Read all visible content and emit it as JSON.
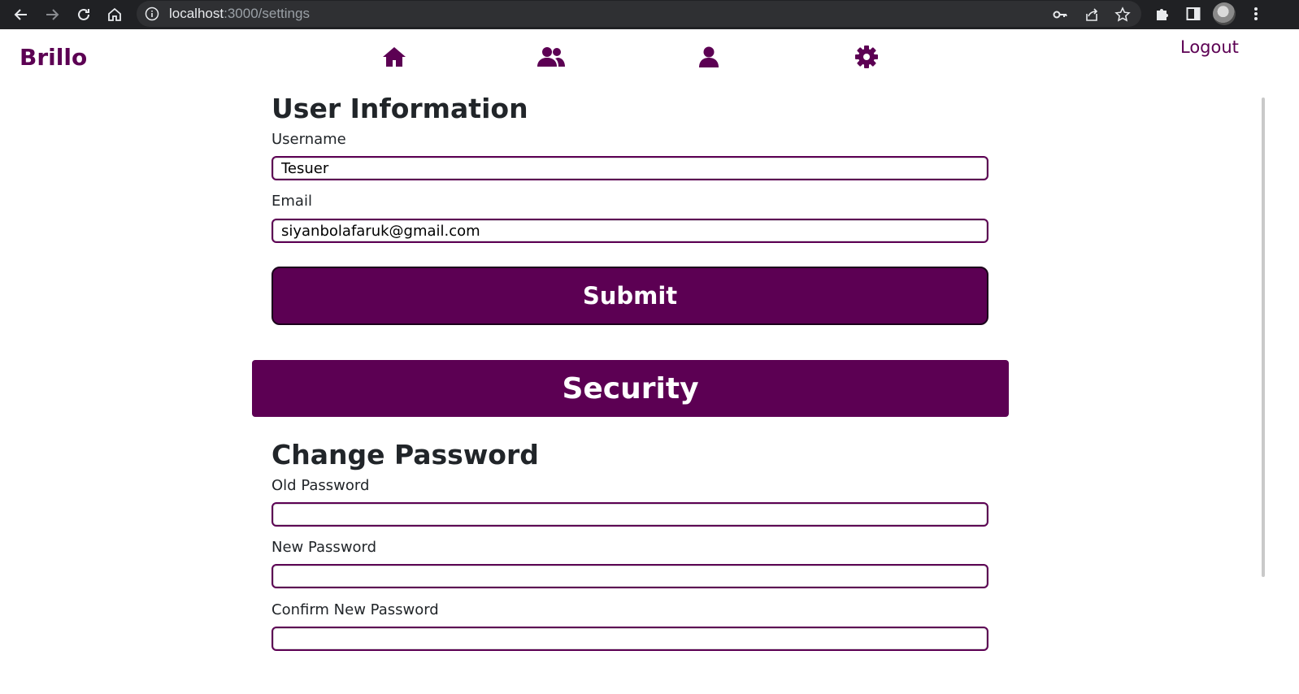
{
  "browser": {
    "url_host": "localhost",
    "url_path": ":3000/settings",
    "icons": {
      "back": "back-arrow-icon",
      "forward": "forward-arrow-icon",
      "reload": "reload-icon",
      "home": "home-icon",
      "site_info": "info-icon",
      "key": "key-icon",
      "share": "share-icon",
      "bookmark": "star-icon",
      "extensions": "puzzle-icon",
      "side_panel": "side-panel-icon",
      "menu": "kebab-menu-icon"
    }
  },
  "app": {
    "brand": "Brillo",
    "logout_label": "Logout",
    "nav": [
      {
        "icon": "home-icon"
      },
      {
        "icon": "friends-icon"
      },
      {
        "icon": "profile-icon"
      },
      {
        "icon": "settings-gear-icon"
      }
    ],
    "accent_color": "#5c0053"
  },
  "user_info": {
    "title": "User Information",
    "username_label": "Username",
    "username_value": "Tesuer",
    "email_label": "Email",
    "email_value": "siyanbolafaruk@gmail.com",
    "submit_label": "Submit"
  },
  "security": {
    "banner": "Security",
    "title": "Change Password",
    "old_password_label": "Old Password",
    "old_password_value": "",
    "new_password_label": "New Password",
    "new_password_value": "",
    "confirm_password_label": "Confirm New Password",
    "confirm_password_value": ""
  }
}
